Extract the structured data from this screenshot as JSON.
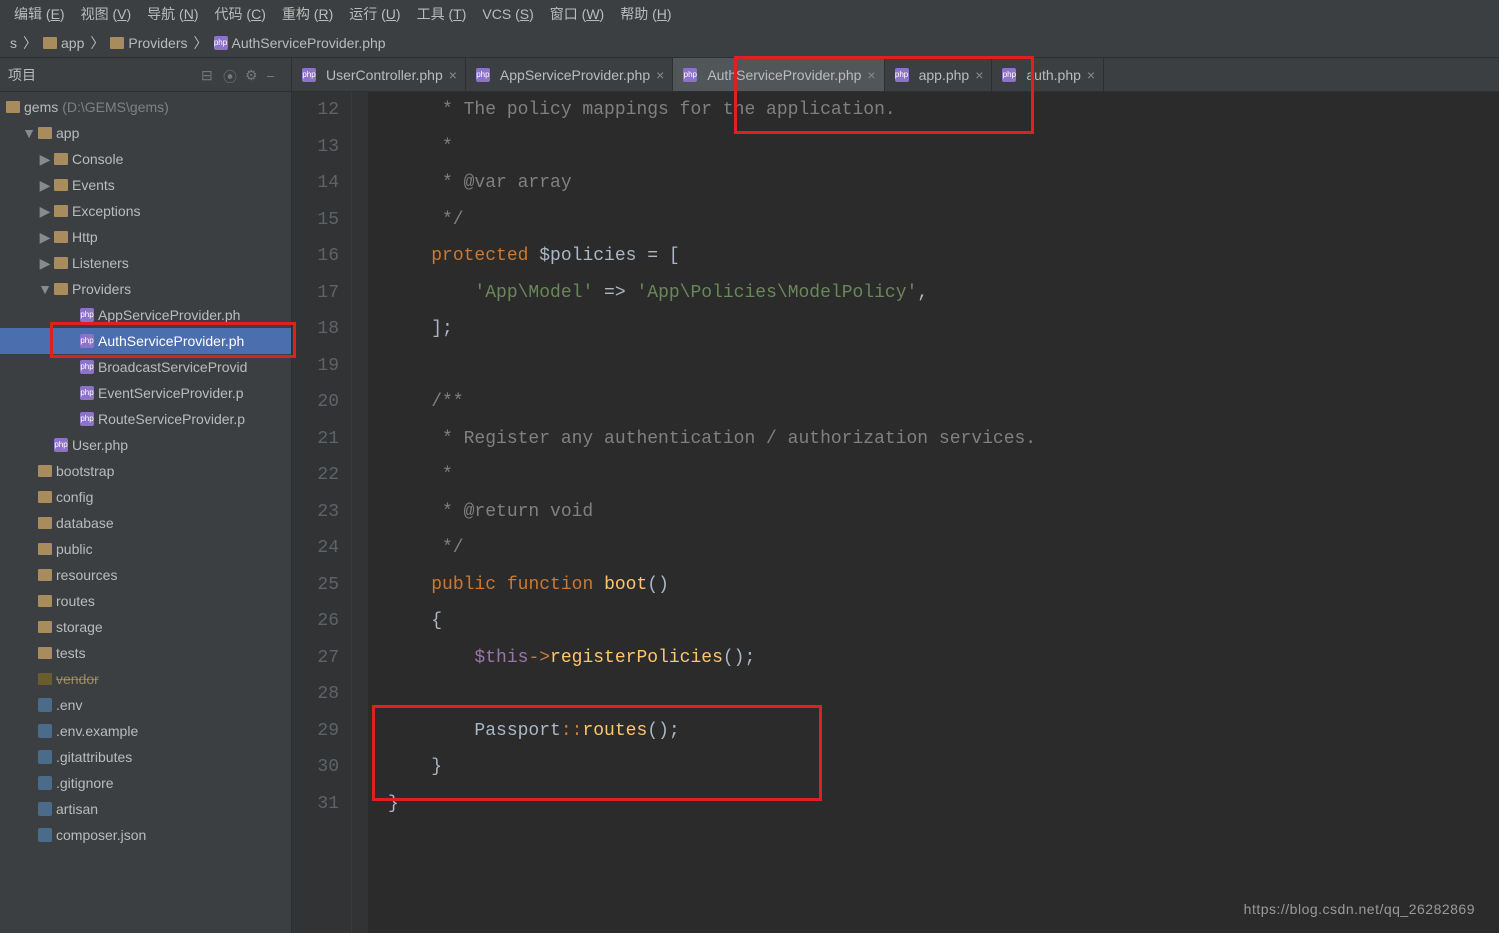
{
  "menu": {
    "items": [
      "编辑 (E)",
      "视图 (V)",
      "导航 (N)",
      "代码 (C)",
      "重构 (R)",
      "运行 (U)",
      "工具 (T)",
      "VCS (S)",
      "窗口 (W)",
      "帮助 (H)"
    ]
  },
  "breadcrumbs": [
    {
      "kind": "arrow",
      "label": "s"
    },
    {
      "kind": "folder",
      "label": "app"
    },
    {
      "kind": "folder",
      "label": "Providers"
    },
    {
      "kind": "php",
      "label": "AuthServiceProvider.php"
    }
  ],
  "sidebar": {
    "title": "项目",
    "root": {
      "name": "gems",
      "path": "(D:\\GEMS\\gems)"
    },
    "tree": [
      {
        "lvl": 1,
        "kind": "folder",
        "arrow": "down",
        "label": "app"
      },
      {
        "lvl": 2,
        "kind": "folder",
        "arrow": "right",
        "label": "Console"
      },
      {
        "lvl": 2,
        "kind": "folder",
        "arrow": "right",
        "label": "Events"
      },
      {
        "lvl": 2,
        "kind": "folder",
        "arrow": "right",
        "label": "Exceptions"
      },
      {
        "lvl": 2,
        "kind": "folder",
        "arrow": "right",
        "label": "Http"
      },
      {
        "lvl": 2,
        "kind": "folder",
        "arrow": "right",
        "label": "Listeners"
      },
      {
        "lvl": 2,
        "kind": "folder",
        "arrow": "down",
        "label": "Providers"
      },
      {
        "lvl": 3,
        "kind": "php",
        "label": "AppServiceProvider.ph"
      },
      {
        "lvl": 3,
        "kind": "php",
        "label": "AuthServiceProvider.ph",
        "sel": true
      },
      {
        "lvl": 3,
        "kind": "php",
        "label": "BroadcastServiceProvid"
      },
      {
        "lvl": 3,
        "kind": "php",
        "label": "EventServiceProvider.p"
      },
      {
        "lvl": 3,
        "kind": "php",
        "label": "RouteServiceProvider.p"
      },
      {
        "lvl": 2,
        "kind": "php",
        "label": "User.php"
      },
      {
        "lvl": 1,
        "kind": "folder",
        "label": "bootstrap"
      },
      {
        "lvl": 1,
        "kind": "folder",
        "label": "config"
      },
      {
        "lvl": 1,
        "kind": "folder",
        "label": "database"
      },
      {
        "lvl": 1,
        "kind": "folder",
        "label": "public"
      },
      {
        "lvl": 1,
        "kind": "folder",
        "label": "resources"
      },
      {
        "lvl": 1,
        "kind": "folder",
        "label": "routes"
      },
      {
        "lvl": 1,
        "kind": "folder",
        "label": "storage"
      },
      {
        "lvl": 1,
        "kind": "folder",
        "label": "tests"
      },
      {
        "lvl": 1,
        "kind": "folder",
        "label": "vendor",
        "excl": true
      },
      {
        "lvl": 1,
        "kind": "file",
        "label": ".env"
      },
      {
        "lvl": 1,
        "kind": "file",
        "label": ".env.example"
      },
      {
        "lvl": 1,
        "kind": "file",
        "label": ".gitattributes"
      },
      {
        "lvl": 1,
        "kind": "file",
        "label": ".gitignore"
      },
      {
        "lvl": 1,
        "kind": "file",
        "label": "artisan"
      },
      {
        "lvl": 1,
        "kind": "file",
        "label": "composer.json"
      }
    ]
  },
  "tabs": [
    {
      "label": "UserController.php",
      "kind": "php"
    },
    {
      "label": "AppServiceProvider.php",
      "kind": "php"
    },
    {
      "label": "AuthServiceProvider.php",
      "kind": "php",
      "active": true
    },
    {
      "label": "app.php",
      "kind": "php"
    },
    {
      "label": "auth.php",
      "kind": "php"
    }
  ],
  "editor": {
    "start": 12,
    "lines": [
      "     * The policy mappings for the application.",
      "     *",
      "     * @var array",
      "     */",
      "    protected $policies = [",
      "        'App\\Model' => 'App\\Policies\\ModelPolicy',",
      "    ];",
      "",
      "    /**",
      "     * Register any authentication / authorization services.",
      "     *",
      "     * @return void",
      "     */",
      "    public function boot()",
      "    {",
      "        $this->registerPolicies();",
      "",
      "        Passport::routes();",
      "    }",
      "}"
    ]
  },
  "watermark": "https://blog.csdn.net/qq_26282869"
}
